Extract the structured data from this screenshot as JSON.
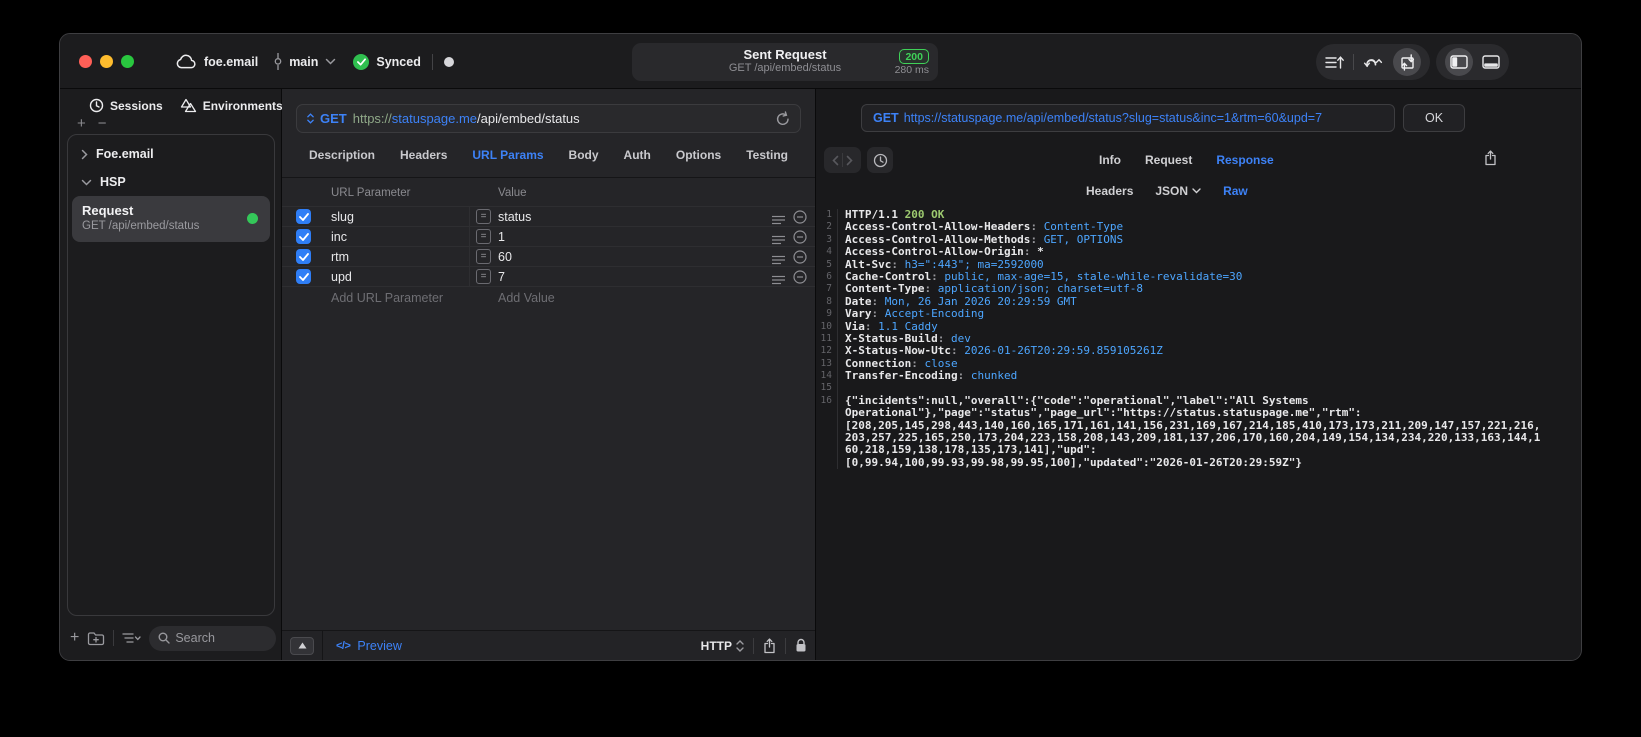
{
  "titlebar": {
    "workspace": "foe.email",
    "branch": "main",
    "sync_status": "Synced",
    "request_title": "Sent Request",
    "request_subtitle": "GET /api/embed/status",
    "status_code": "200",
    "duration": "280 ms"
  },
  "sidebar": {
    "tabs": [
      "Sessions",
      "Environments"
    ],
    "tree": [
      {
        "label": "Foe.email",
        "expanded": false
      },
      {
        "label": "HSP",
        "expanded": true
      }
    ],
    "selected_request": {
      "name": "Request",
      "subtitle": "GET /api/embed/status"
    },
    "search_placeholder": "Search"
  },
  "request_editor": {
    "method": "GET",
    "url_scheme": "https://",
    "url_host": "statuspage.me",
    "url_path": "/api/embed/status",
    "tabs": [
      "Description",
      "Headers",
      "URL Params",
      "Body",
      "Auth",
      "Options",
      "Testing"
    ],
    "active_tab": "URL Params",
    "params": {
      "col_name": "URL Parameter",
      "col_value": "Value",
      "rows": [
        {
          "name": "slug",
          "value": "status",
          "enabled": true
        },
        {
          "name": "inc",
          "value": "1",
          "enabled": true
        },
        {
          "name": "rtm",
          "value": "60",
          "enabled": true
        },
        {
          "name": "upd",
          "value": "7",
          "enabled": true
        }
      ],
      "add_name_placeholder": "Add URL Parameter",
      "add_value_placeholder": "Add Value"
    },
    "footer": {
      "preview_label": "Preview",
      "code_glyph": "</>",
      "protocol": "HTTP"
    }
  },
  "response_viewer": {
    "method": "GET",
    "url": "https://statuspage.me/api/embed/status?slug=status&inc=1&rtm=60&upd=7",
    "status_code": "200",
    "status_text": "OK",
    "tabs": [
      "Info",
      "Request",
      "Response"
    ],
    "active_tab": "Response",
    "subtabs": [
      "Headers",
      "JSON",
      "Raw"
    ],
    "active_subtab": "Raw",
    "code_lines": [
      {
        "n": "1",
        "segs": [
          {
            "t": "HTTP/1.1 ",
            "c": "n"
          },
          {
            "t": "200 OK",
            "c": "g"
          }
        ]
      },
      {
        "n": "2",
        "segs": [
          {
            "t": "Access-Control-Allow-Headers",
            "c": "n"
          },
          {
            "t": ": ",
            "c": "s"
          },
          {
            "t": "Content-Type",
            "c": "v"
          }
        ]
      },
      {
        "n": "3",
        "segs": [
          {
            "t": "Access-Control-Allow-Methods",
            "c": "n"
          },
          {
            "t": ": ",
            "c": "s"
          },
          {
            "t": "GET, OPTIONS",
            "c": "v"
          }
        ]
      },
      {
        "n": "4",
        "segs": [
          {
            "t": "Access-Control-Allow-Origin",
            "c": "n"
          },
          {
            "t": ": ",
            "c": "s"
          },
          {
            "t": "*",
            "c": "n"
          }
        ]
      },
      {
        "n": "5",
        "segs": [
          {
            "t": "Alt-Svc",
            "c": "n"
          },
          {
            "t": ": ",
            "c": "s"
          },
          {
            "t": "h3=\":443\"; ma=2592000",
            "c": "v"
          }
        ]
      },
      {
        "n": "6",
        "segs": [
          {
            "t": "Cache-Control",
            "c": "n"
          },
          {
            "t": ": ",
            "c": "s"
          },
          {
            "t": "public, max-age=15, stale-while-revalidate=30",
            "c": "v"
          }
        ]
      },
      {
        "n": "7",
        "segs": [
          {
            "t": "Content-Type",
            "c": "n"
          },
          {
            "t": ": ",
            "c": "s"
          },
          {
            "t": "application/json; charset=utf-8",
            "c": "v"
          }
        ]
      },
      {
        "n": "8",
        "segs": [
          {
            "t": "Date",
            "c": "n"
          },
          {
            "t": ": ",
            "c": "s"
          },
          {
            "t": "Mon, 26 Jan 2026 20:29:59 GMT",
            "c": "v"
          }
        ]
      },
      {
        "n": "9",
        "segs": [
          {
            "t": "Vary",
            "c": "n"
          },
          {
            "t": ": ",
            "c": "s"
          },
          {
            "t": "Accept-Encoding",
            "c": "v"
          }
        ]
      },
      {
        "n": "10",
        "segs": [
          {
            "t": "Via",
            "c": "n"
          },
          {
            "t": ": ",
            "c": "s"
          },
          {
            "t": "1.1 Caddy",
            "c": "v"
          }
        ]
      },
      {
        "n": "11",
        "segs": [
          {
            "t": "X-Status-Build",
            "c": "n"
          },
          {
            "t": ": ",
            "c": "s"
          },
          {
            "t": "dev",
            "c": "v"
          }
        ]
      },
      {
        "n": "12",
        "segs": [
          {
            "t": "X-Status-Now-Utc",
            "c": "n"
          },
          {
            "t": ": ",
            "c": "s"
          },
          {
            "t": "2026-01-26T20:29:59.859105261Z",
            "c": "v"
          }
        ]
      },
      {
        "n": "13",
        "segs": [
          {
            "t": "Connection",
            "c": "n"
          },
          {
            "t": ": ",
            "c": "s"
          },
          {
            "t": "close",
            "c": "v"
          }
        ]
      },
      {
        "n": "14",
        "segs": [
          {
            "t": "Transfer-Encoding",
            "c": "n"
          },
          {
            "t": ": ",
            "c": "s"
          },
          {
            "t": "chunked",
            "c": "v"
          }
        ]
      },
      {
        "n": "15",
        "segs": []
      },
      {
        "n": "16",
        "segs": [
          {
            "t": "{\"incidents\":null,\"overall\":{\"code\":\"operational\",\"label\":\"All Systems",
            "c": "n"
          }
        ]
      },
      {
        "n": "",
        "segs": [
          {
            "t": "Operational\"},\"page\":\"status\",\"page_url\":\"https://status.statuspage.me\",\"rtm\":",
            "c": "n"
          }
        ]
      },
      {
        "n": "",
        "segs": [
          {
            "t": "[208,205,145,298,443,140,160,165,171,161,141,156,231,169,167,214,185,410,173,173,211,209,147,157,221,216,",
            "c": "n"
          }
        ]
      },
      {
        "n": "",
        "segs": [
          {
            "t": "203,257,225,165,250,173,204,223,158,208,143,209,181,137,206,170,160,204,149,154,134,234,220,133,163,144,1",
            "c": "n"
          }
        ]
      },
      {
        "n": "",
        "segs": [
          {
            "t": "60,218,159,138,178,135,173,141],\"upd\":",
            "c": "n"
          }
        ]
      },
      {
        "n": "",
        "segs": [
          {
            "t": "[0,99.94,100,99.93,99.98,99.95,100],\"updated\":\"2026-01-26T20:29:59Z\"}",
            "c": "n"
          }
        ]
      }
    ]
  },
  "colors": {
    "accent_blue": "#3d82f7",
    "code_value_blue": "#4da6ff",
    "status_green": "#3fd158",
    "code_green": "#9dc96f",
    "checkbox_blue": "#2f7ef6",
    "synced_green": "#2fbf4f",
    "active_dot_green": "#34c759"
  }
}
